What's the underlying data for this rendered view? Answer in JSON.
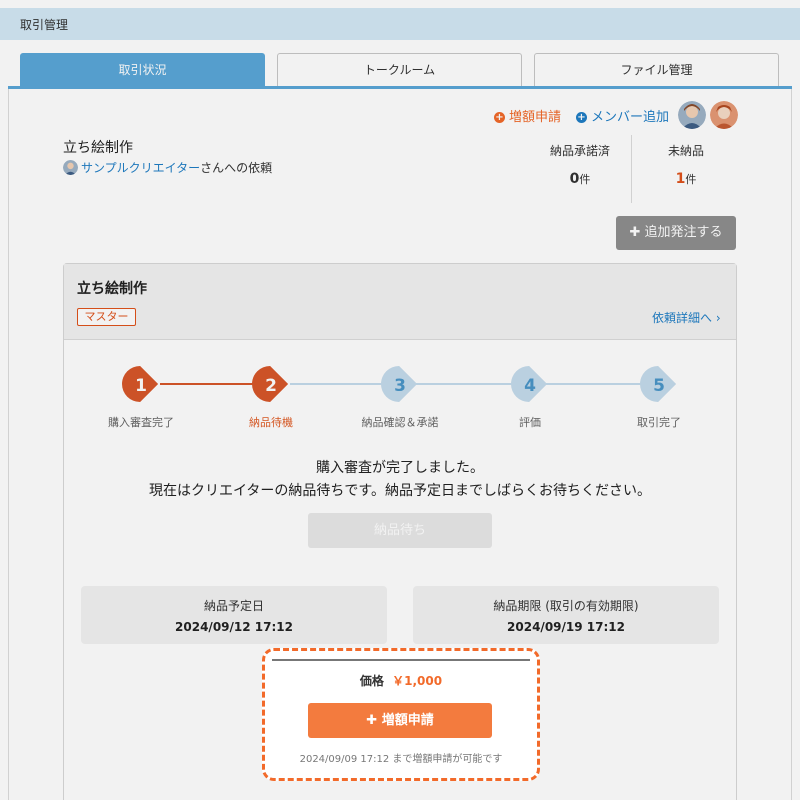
{
  "header": {
    "title": "取引管理"
  },
  "tabs": [
    {
      "label": "取引状況",
      "active": true
    },
    {
      "label": "トークルーム",
      "active": false
    },
    {
      "label": "ファイル管理",
      "active": false
    }
  ],
  "actions": {
    "increase_label": "増額申請",
    "add_member_label": "メンバー追加"
  },
  "order": {
    "title": "立ち絵制作",
    "creator_name": "サンプルクリエイター",
    "request_suffix": "さんへの依頼"
  },
  "stats": {
    "approved_label": "納品承諾済",
    "approved_count": "0",
    "pending_label": "未納品",
    "pending_count": "1",
    "unit": "件"
  },
  "add_order_label": "追加発注する",
  "card": {
    "title": "立ち絵制作",
    "badge": "マスター",
    "detail_link": "依頼詳細へ ›"
  },
  "steps": [
    {
      "number": "1",
      "label": "購入審査完了",
      "state": "done"
    },
    {
      "number": "2",
      "label": "納品待機",
      "state": "current"
    },
    {
      "number": "3",
      "label": "納品確認＆承諾",
      "state": "todo"
    },
    {
      "number": "4",
      "label": "評価",
      "state": "todo"
    },
    {
      "number": "5",
      "label": "取引完了",
      "state": "todo"
    }
  ],
  "message": {
    "line1": "購入審査が完了しました。",
    "line2": "現在はクリエイターの納品待ちです。納品予定日までしばらくお待ちください。"
  },
  "waiting_button": "納品待ち",
  "dates": {
    "scheduled_label": "納品予定日",
    "scheduled_value": "2024/09/12 17:12",
    "deadline_label": "納品期限 (取引の有効期限)",
    "deadline_value": "2024/09/19 17:12"
  },
  "price": {
    "label": "価格",
    "value": "￥1,000",
    "increase_button": "増額申請",
    "note": "2024/09/09 17:12 まで増額申請が可能です"
  },
  "colors": {
    "accent_blue": "#5aa7d8",
    "accent_orange": "#f26a2a",
    "step_done": "#d7572a",
    "step_todo": "#c5dcec"
  }
}
